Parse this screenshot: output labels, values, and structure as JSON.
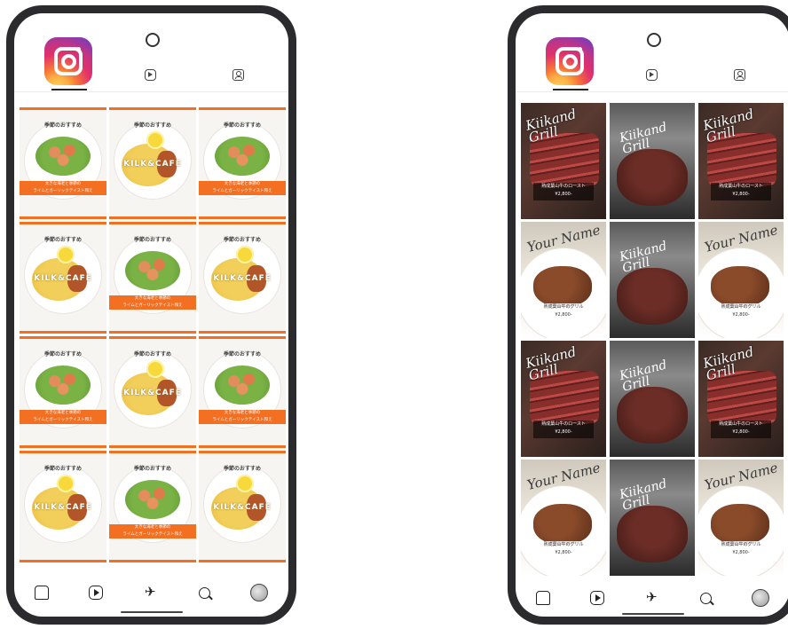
{
  "left_phone": {
    "tabs": [
      {
        "icon": "grid-icon",
        "active": true
      },
      {
        "icon": "reels-icon",
        "active": false
      },
      {
        "icon": "tagged-icon",
        "active": false
      }
    ],
    "brand": "Instagram",
    "colors": {
      "accent": "#f36f21",
      "frame": "#2b2b2d"
    },
    "tile_texts": {
      "title": "季節のおすすめ",
      "band_line1": "大きな海老と季節の",
      "band_line2": "ライムとガーリックテイスト和え",
      "logo": "KILK&CAFE"
    }
  },
  "right_phone": {
    "tile_texts": {
      "steak_script": "Kiikand Grill",
      "steak_caption_line1": "熟成葉山牛のロースト",
      "steak_caption_line2": "¥2,800-",
      "grill_script": "Your Name",
      "grill_caption_line1": "熟成葉山牛のグリル",
      "grill_caption_line2": "¥2,800-"
    }
  },
  "bottom_nav": {
    "items": [
      "home-icon",
      "reels-icon",
      "send-icon",
      "search-icon",
      "avatar"
    ]
  }
}
